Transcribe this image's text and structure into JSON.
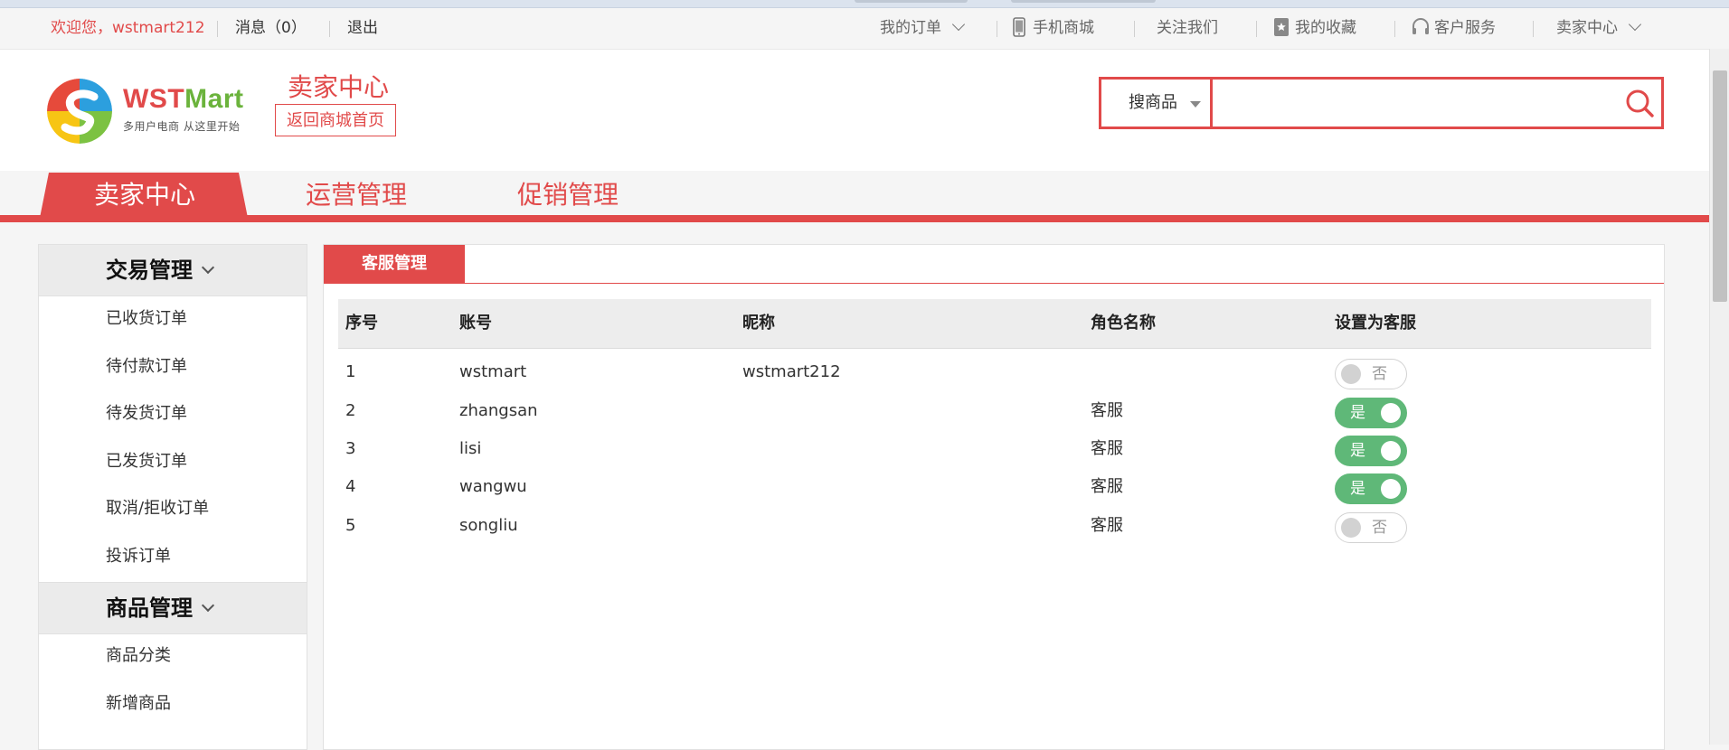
{
  "colors": {
    "accent": "#e14a4a",
    "toggle_on": "#5fb878",
    "toggle_off": "#d2d2d2"
  },
  "topbar": {
    "welcome": "欢迎您，wstmart212",
    "messages": "消息（0）",
    "logout": "退出",
    "my_orders": "我的订单",
    "mobile_mall": "手机商城",
    "follow_us": "关注我们",
    "favorites": "我的收藏",
    "customer_service": "客户服务",
    "seller_center": "卖家中心"
  },
  "header": {
    "logo_name_a": "WST",
    "logo_name_b": "Mart",
    "logo_tagline": "多用户电商  从这里开始",
    "seller_title": "卖家中心",
    "home_button": "返回商城首页",
    "search_type": "搜商品",
    "search_value": ""
  },
  "nav": {
    "tabs": [
      "卖家中心",
      "运营管理",
      "促销管理"
    ],
    "active_index": 0
  },
  "sidebar": {
    "groups": [
      {
        "title": "交易管理",
        "items": [
          "已收货订单",
          "待付款订单",
          "待发货订单",
          "已发货订单",
          "取消/拒收订单",
          "投诉订单"
        ]
      },
      {
        "title": "商品管理",
        "items": [
          "商品分类",
          "新增商品"
        ]
      }
    ]
  },
  "panel": {
    "tab": "客服管理",
    "columns": [
      "序号",
      "账号",
      "昵称",
      "角色名称",
      "设置为客服"
    ],
    "rows": [
      {
        "no": "1",
        "account": "wstmart",
        "nickname": "wstmart212",
        "role": "",
        "is_service": false,
        "toggle_label": "否"
      },
      {
        "no": "2",
        "account": "zhangsan",
        "nickname": "",
        "role": "客服",
        "is_service": true,
        "toggle_label": "是"
      },
      {
        "no": "3",
        "account": "lisi",
        "nickname": "",
        "role": "客服",
        "is_service": true,
        "toggle_label": "是"
      },
      {
        "no": "4",
        "account": "wangwu",
        "nickname": "",
        "role": "客服",
        "is_service": true,
        "toggle_label": "是"
      },
      {
        "no": "5",
        "account": "songliu",
        "nickname": "",
        "role": "客服",
        "is_service": false,
        "toggle_label": "否"
      }
    ]
  }
}
